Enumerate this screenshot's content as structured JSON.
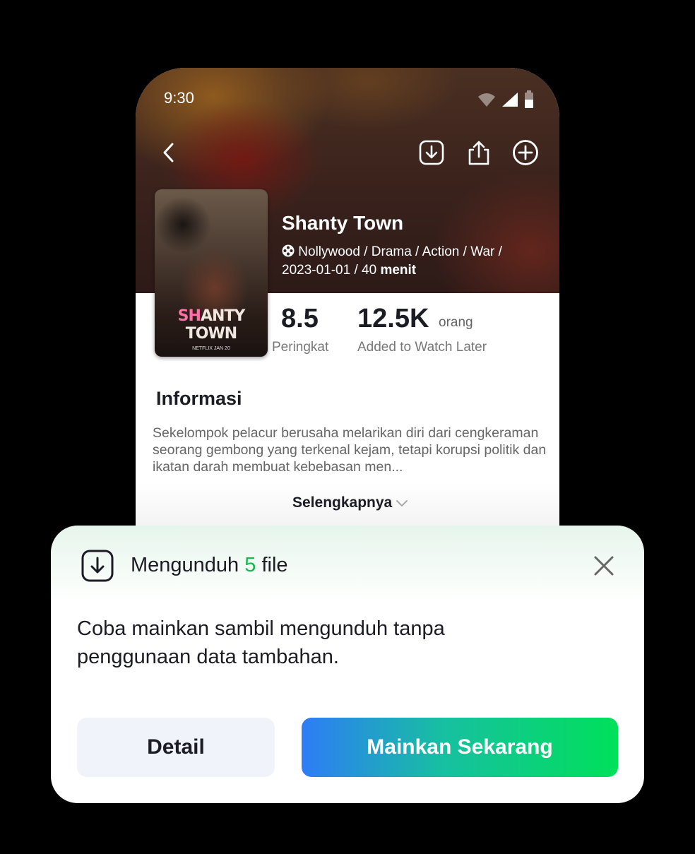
{
  "status_bar": {
    "time": "9:30"
  },
  "movie": {
    "title": "Shanty Town",
    "genres": "Nollywood / Drama / Action / War /",
    "date_duration": "2023-01-01 / 40 ",
    "duration_unit": "menit",
    "poster": {
      "title_pink": "SH",
      "title_rest": "ANTY TOWN",
      "sub": "NETFLIX  JAN 20"
    }
  },
  "stats": {
    "rating_value": "8.5",
    "rating_label": "Peringkat",
    "watch_later_value": "12.5K",
    "watch_later_unit": "orang",
    "watch_later_label": "Added to Watch Later"
  },
  "info": {
    "title": "Informasi",
    "description": "Sekelompok pelacur berusaha melarikan diri dari cengkeraman seorang gembong yang terkenal kejam, tetapi korupsi politik dan ikatan darah membuat kebebasan men...",
    "more_label": "Selengkapnya"
  },
  "download_sheet": {
    "title_prefix": "Mengunduh ",
    "file_count": "5",
    "title_suffix": " file",
    "body": "Coba mainkan sambil mengunduh tanpa penggunaan data tambahan.",
    "detail_button": "Detail",
    "play_button": "Mainkan Sekarang"
  },
  "icons": {
    "back": "chevron-left-icon",
    "download": "download-icon",
    "share": "share-icon",
    "add": "plus-circle-icon",
    "close": "close-icon"
  },
  "colors": {
    "accent_green": "#19b84f",
    "play_gradient_start": "#2e7cf6",
    "play_gradient_end": "#00e05a",
    "poster_title_pink": "#ff6fa8"
  }
}
